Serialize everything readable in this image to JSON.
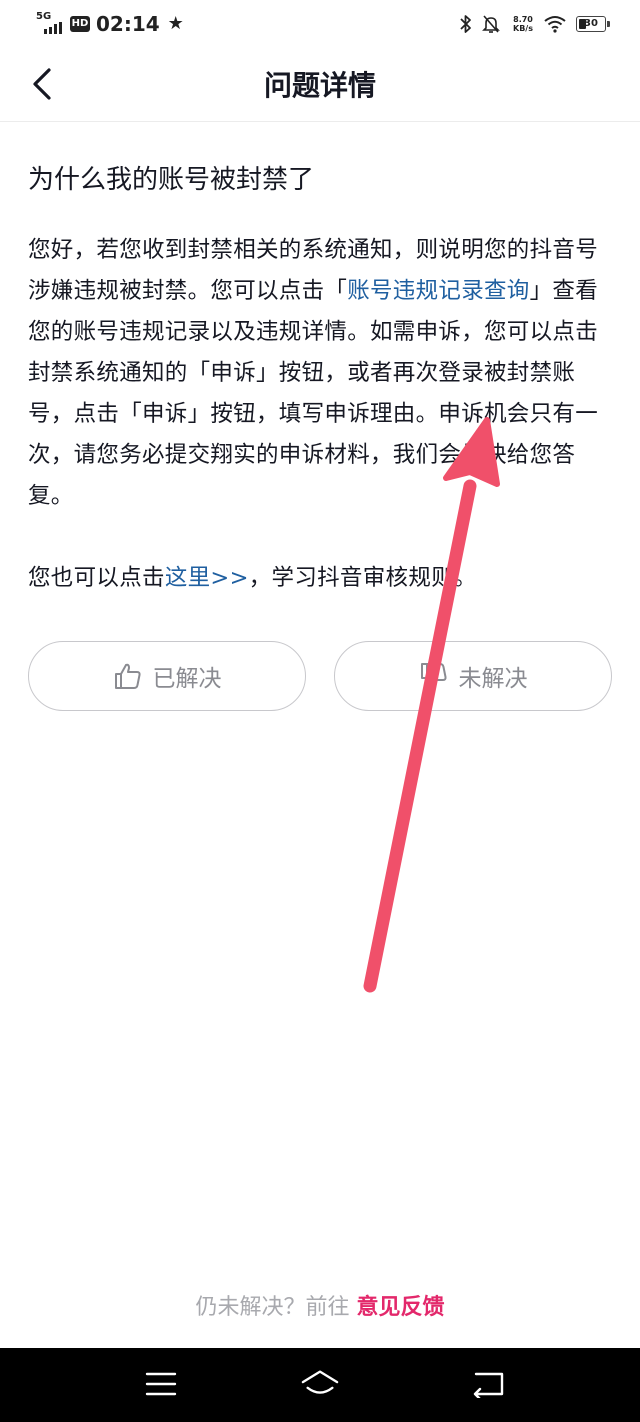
{
  "status_bar": {
    "network": "5G",
    "hd": "HD",
    "time": "02:14",
    "speed_value": "8.70",
    "speed_unit": "KB/s",
    "battery": "30"
  },
  "header": {
    "back_icon": "chevron-left-icon",
    "title": "问题详情"
  },
  "question": {
    "title": "为什么我的账号被封禁了"
  },
  "answer": {
    "p1_before_link": "您好，若您收到封禁相关的系统通知，则说明您的抖音号涉嫌违规被封禁。您可以点击「",
    "p1_link": "账号违规记录查询",
    "p1_after_link": "」查看您的账号违规记录以及违规详情。如需申诉，您可以点击封禁系统通知的「申诉」按钮，或者再次登录被封禁账号，点击「申诉」按钮，填写申诉理由。申诉机会只有一次，请您务必提交翔实的申诉材料，我们会尽快给您答复。",
    "p2_before_link": "您也可以点击",
    "p2_link": "这里>>",
    "p2_after_link": "，学习抖音审核规则。"
  },
  "feedback": {
    "resolved_label": "已解决",
    "resolved_icon": "thumbs-up-icon",
    "unresolved_label": "未解决",
    "unresolved_icon": "thumbs-down-icon"
  },
  "bottom_hint": {
    "prefix": "仍未解决？前往 ",
    "link": "意见反馈"
  },
  "system_nav": {
    "menu_icon": "menu-icon",
    "home_icon": "home-icon",
    "back_icon": "back-icon"
  },
  "colors": {
    "link": "#1f5fa0",
    "feedback_link": "#e3286b",
    "annotation_arrow": "#f0506a",
    "text": "#161823",
    "muted": "#8a8b91"
  }
}
